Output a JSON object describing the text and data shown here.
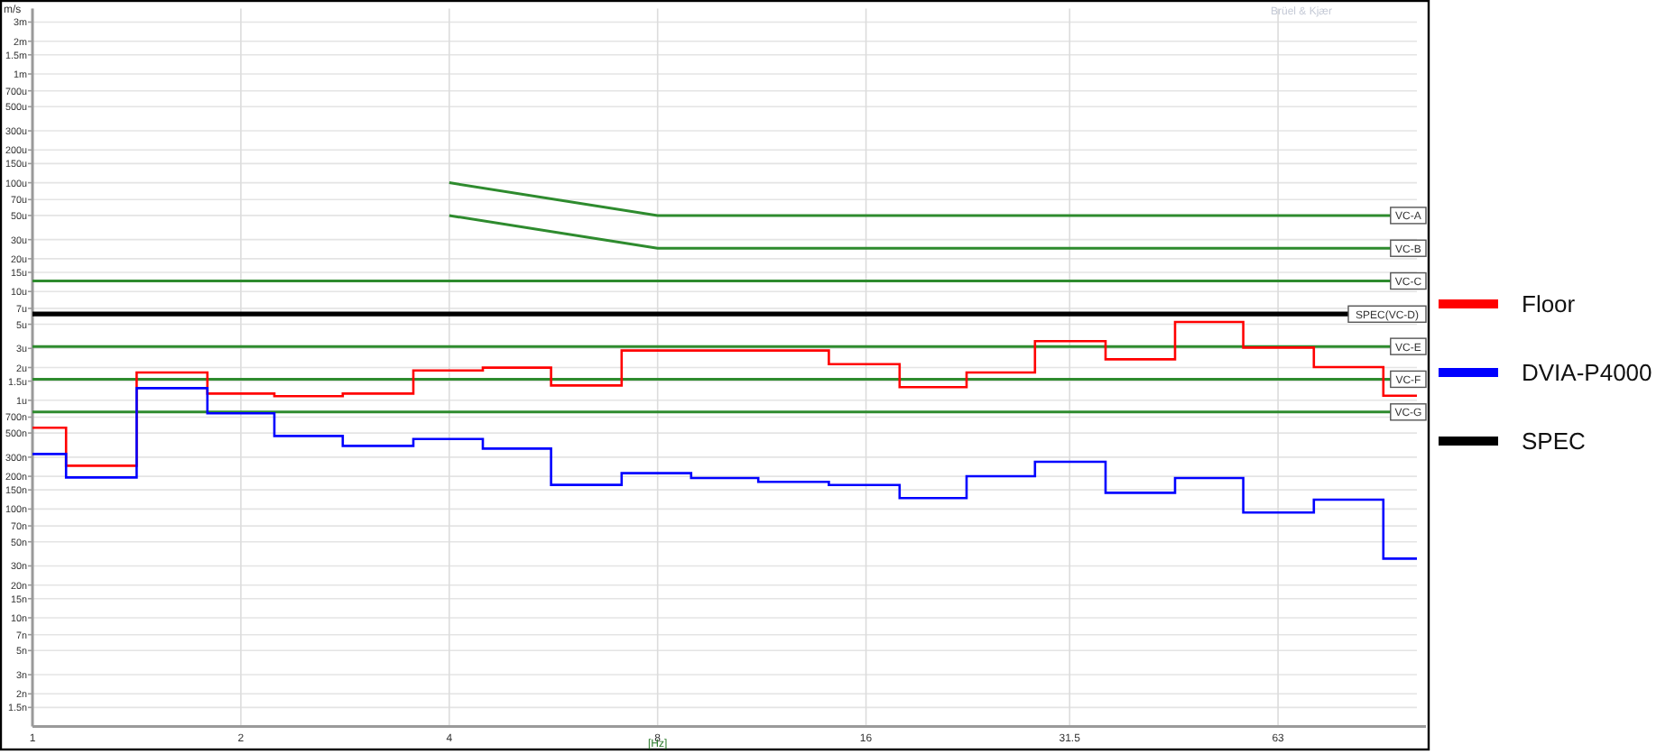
{
  "plot": {
    "logo": "Brüel & Kjær",
    "y_axis_unit": "m/s",
    "x_axis_title": "[Hz]",
    "y_axis_labels": [
      "3m",
      "2m",
      "1.5m",
      "1m",
      "700u",
      "500u",
      "300u",
      "200u",
      "150u",
      "100u",
      "70u",
      "50u",
      "30u",
      "20u",
      "15u",
      "10u",
      "7u",
      "5u",
      "3u",
      "2u",
      "1.5u",
      "1u",
      "700n",
      "500n",
      "300n",
      "200n",
      "150n",
      "100n",
      "70n",
      "50n",
      "30n",
      "20n",
      "15n",
      "10n",
      "7n",
      "5n",
      "3n",
      "2n",
      "1.5n"
    ],
    "x_axis_labels": [
      "1",
      "2",
      "4",
      "8",
      "16",
      "31.5",
      "63"
    ],
    "limit_labels": [
      "VC-A",
      "VC-B",
      "VC-C",
      "SPEC(VC-D)",
      "VC-E",
      "VC-F",
      "VC-G"
    ],
    "legend": [
      {
        "label": "Floor",
        "color": "#ff0000"
      },
      {
        "label": "DVIA-P4000",
        "color": "#0000ff"
      },
      {
        "label": "SPEC",
        "color": "#000000"
      }
    ]
  }
}
